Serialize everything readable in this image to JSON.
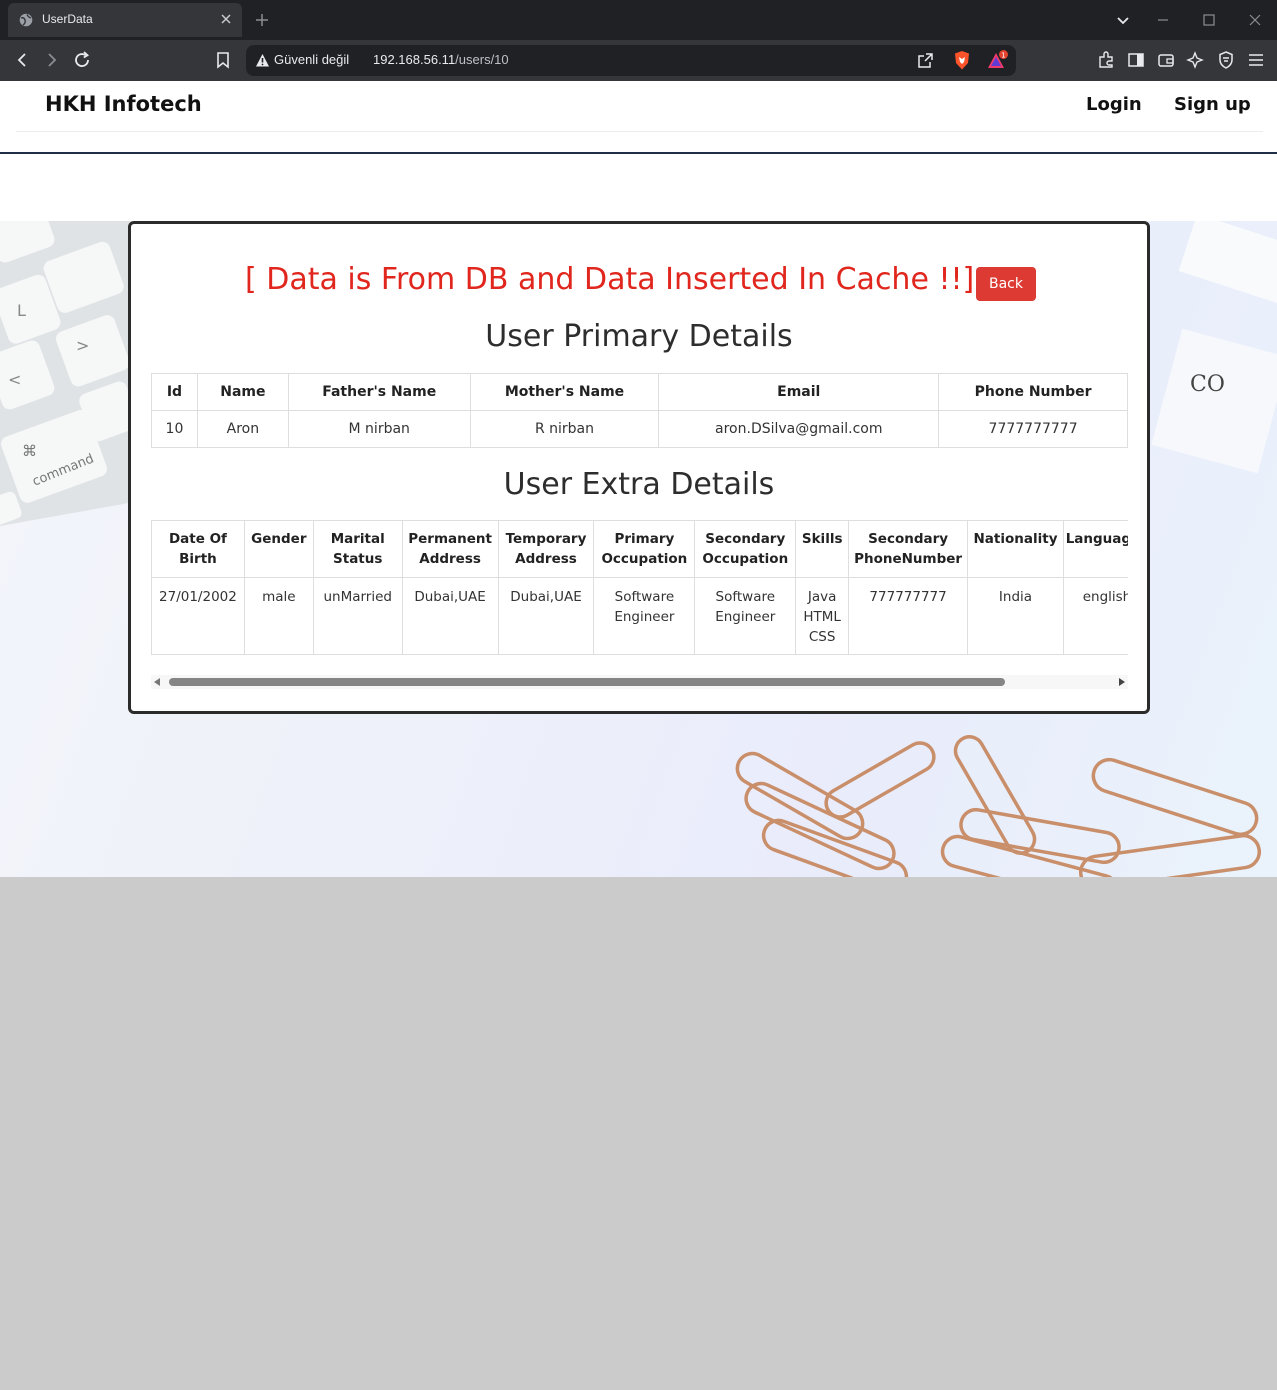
{
  "browser": {
    "tab_title": "UserData",
    "security_label": "Güvenli değil",
    "url_host": "192.168.56.11",
    "url_path": "/users/10",
    "shield_badge": "1"
  },
  "nav": {
    "brand": "HKH Infotech",
    "login": "Login",
    "signup": "Sign up"
  },
  "card": {
    "headline": "[ Data is From DB and Data Inserted In Cache !!]",
    "back_label": "Back",
    "primary_title": "User Primary Details",
    "extra_title": "User Extra Details"
  },
  "primary": {
    "headers": [
      "Id",
      "Name",
      "Father's Name",
      "Mother's Name",
      "Email",
      "Phone Number"
    ],
    "row": [
      "10",
      "Aron",
      "M nirban",
      "R nirban",
      "aron.DSilva@gmail.com",
      "7777777777"
    ]
  },
  "extra": {
    "headers": [
      [
        "Date Of",
        "Birth"
      ],
      [
        "Gender",
        ""
      ],
      [
        "Marital",
        "Status"
      ],
      [
        "Permanent",
        "Address"
      ],
      [
        "Temporary",
        "Address"
      ],
      [
        "Primary",
        "Occupation"
      ],
      [
        "Secondary",
        "Occupation"
      ],
      [
        "Skills",
        ""
      ],
      [
        "Secondary",
        "PhoneNumber"
      ],
      [
        "Nationality",
        ""
      ],
      [
        "Languages",
        ""
      ]
    ],
    "row": [
      [
        "27/01/2002",
        "",
        ""
      ],
      [
        "male",
        "",
        ""
      ],
      [
        "unMarried",
        "",
        ""
      ],
      [
        "Dubai,UAE",
        "",
        ""
      ],
      [
        "Dubai,UAE",
        "",
        ""
      ],
      [
        "Software",
        "Engineer",
        ""
      ],
      [
        "Software",
        "Engineer",
        ""
      ],
      [
        "Java",
        "HTML",
        "CSS"
      ],
      [
        "777777777",
        "",
        ""
      ],
      [
        "India",
        "",
        ""
      ],
      [
        "english",
        "",
        ""
      ]
    ]
  },
  "colors": {
    "headline": "#e0261d",
    "back_button": "#dc3a33",
    "nav_rule": "#1f2d46"
  }
}
